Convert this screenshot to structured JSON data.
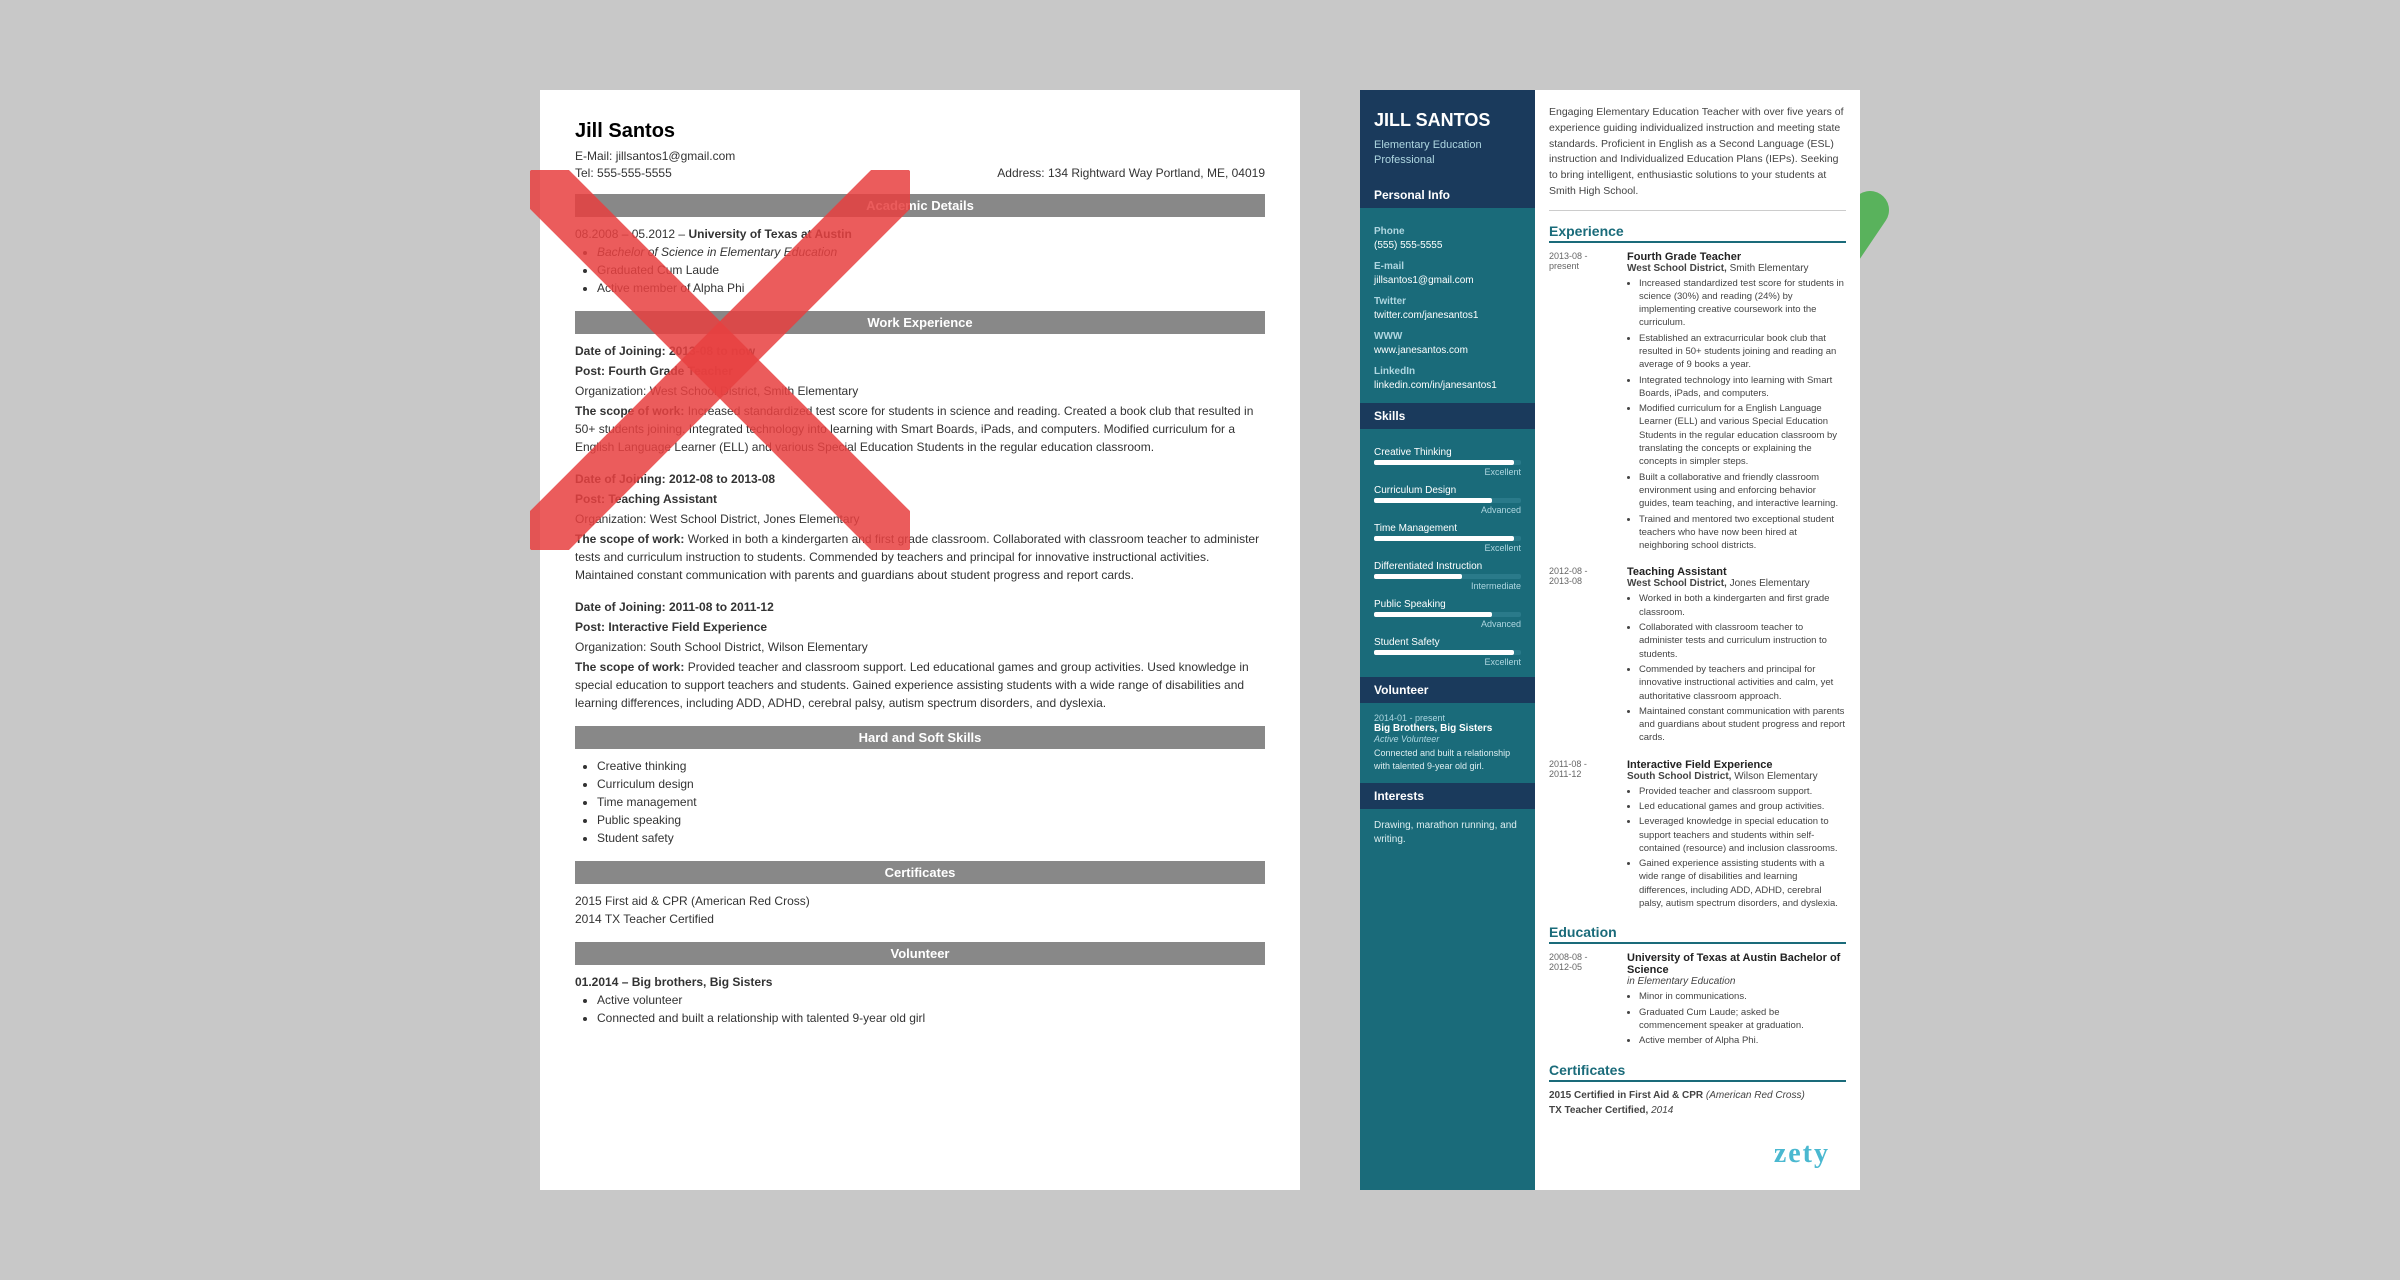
{
  "left": {
    "name": "Jill Santos",
    "email_label": "E-Mail:",
    "email": "jillsantos1@gmail.com",
    "address_label": "Address:",
    "address": "134 Rightward Way Portland, ME, 04019",
    "tel_label": "Tel:",
    "tel": "555-555-5555",
    "sections": {
      "academic": "Academic Details",
      "work": "Work Experience",
      "hard_soft": "Hard and Soft Skills",
      "certificates": "Certificates",
      "volunteer": "Volunteer"
    },
    "academic": {
      "dates": "08.2008 – 05.2012 –",
      "university": "University of Texas at Austin",
      "bullet1": "Bachelor of Science in Elementary Education",
      "bullet2": "Graduated Cum Laude",
      "bullet3": "Active member of Alpha Phi"
    },
    "work": [
      {
        "date": "Date of Joining: 2013-08 to now",
        "post": "Post: Fourth Grade Teacher",
        "org": "Organization: West School District, Smith Elementary",
        "scope_label": "The scope of work:",
        "scope": "Increased standardized test score for students in science and reading. Created a book club that resulted in 50+ students joining. Integrated technology into learning with Smart Boards, iPads, and computers. Modified curriculum for a English Language Learner (ELL) and various Special Education Students in the regular education classroom."
      },
      {
        "date": "Date of Joining: 2012-08 to 2013-08",
        "post": "Post: Teaching Assistant",
        "org": "Organization: West School District, Jones Elementary",
        "scope_label": "The scope of work:",
        "scope": "Worked in both a kindergarten and first grade classroom. Collaborated with classroom teacher to administer tests and curriculum instruction to students. Commended by teachers and principal for innovative instructional activities. Maintained constant communication with parents and guardians about student progress and report cards."
      },
      {
        "date": "Date of Joining: 2011-08 to 2011-12",
        "post": "Post: Interactive Field Experience",
        "org": "Organization: South School District, Wilson Elementary",
        "scope_label": "The scope of work:",
        "scope": "Provided teacher and classroom support. Led educational games and group activities. Used knowledge in special education to support teachers and students. Gained experience assisting students with a wide range of disabilities and learning differences, including ADD, ADHD, cerebral palsy, autism spectrum disorders, and dyslexia."
      }
    ],
    "skills": [
      "Creative thinking",
      "Curriculum design",
      "Time management",
      "Public speaking",
      "Student safety"
    ],
    "certs": [
      "2015 First aid & CPR (American Red Cross)",
      "2014 TX Teacher Certified"
    ],
    "volunteer": {
      "date": "01.2014 – Big brothers, Big Sisters",
      "bullet1": "Active volunteer",
      "bullet2": "Connected and built a relationship with talented 9-year old girl"
    }
  },
  "right": {
    "name": "JILL SANTOS",
    "title": "Elementary Education Professional",
    "summary": "Engaging Elementary Education Teacher with over five years of experience guiding individualized instruction and meeting state standards. Proficient in English as a Second Language (ESL) instruction and Individualized Education Plans (IEPs). Seeking to bring intelligent, enthusiastic solutions to your students at Smith High School.",
    "sidebar": {
      "personal_info": "Personal Info",
      "phone_label": "Phone",
      "phone": "(555) 555-5555",
      "email_label": "E-mail",
      "email": "jillsantos1@gmail.com",
      "twitter_label": "Twitter",
      "twitter": "twitter.com/janesantos1",
      "www_label": "WWW",
      "www": "www.janesantos.com",
      "linkedin_label": "LinkedIn",
      "linkedin": "linkedin.com/in/janesantos1",
      "skills_title": "Skills",
      "skills": [
        {
          "name": "Creative Thinking",
          "level": "Excellent",
          "pct": 95
        },
        {
          "name": "Curriculum Design",
          "level": "Advanced",
          "pct": 80
        },
        {
          "name": "Time Management",
          "level": "Excellent",
          "pct": 95
        },
        {
          "name": "Differentiated Instruction",
          "level": "Intermediate",
          "pct": 60
        },
        {
          "name": "Public Speaking",
          "level": "Advanced",
          "pct": 80
        },
        {
          "name": "Student Safety",
          "level": "Excellent",
          "pct": 95
        }
      ],
      "volunteer_title": "Volunteer",
      "volunteer": {
        "date": "2014-01 - present",
        "org": "Big Brothers, Big Sisters",
        "role": "Active Volunteer",
        "bullets": [
          "Connected and built a relationship with talented 9-year old girl."
        ]
      },
      "interests_title": "Interests",
      "interests": "Drawing, marathon running, and writing."
    },
    "experience_title": "Experience",
    "experience": [
      {
        "date_start": "2013-08 -",
        "date_end": "present",
        "title": "Fourth Grade Teacher",
        "org_bold": "West School District,",
        "org_rest": " Smith Elementary",
        "bullets": [
          "Increased standardized test score for students in science (30%) and reading (24%) by implementing creative coursework into the curriculum.",
          "Established an extracurricular book club that resulted in 50+ students joining and reading an average of 9 books a year.",
          "Integrated technology into learning with Smart Boards, iPads, and computers.",
          "Modified curriculum for a English Language Learner (ELL) and various Special Education Students in the regular education classroom by translating the concepts or explaining the concepts in simpler steps.",
          "Built a collaborative and friendly classroom environment using and enforcing behavior guides, team teaching, and interactive learning.",
          "Trained and mentored two exceptional student teachers who have now been hired at neighboring school districts."
        ]
      },
      {
        "date_start": "2012-08 -",
        "date_end": "2013-08",
        "title": "Teaching Assistant",
        "org_bold": "West School District,",
        "org_rest": " Jones Elementary",
        "bullets": [
          "Worked in both a kindergarten and first grade classroom.",
          "Collaborated with classroom teacher to administer tests and curriculum instruction to students.",
          "Commended by teachers and principal for innovative instructional activities and calm, yet authoritative classroom approach.",
          "Maintained constant communication with parents and guardians about student progress and report cards."
        ]
      },
      {
        "date_start": "2011-08 -",
        "date_end": "2011-12",
        "title": "Interactive Field Experience",
        "org_bold": "South School District,",
        "org_rest": " Wilson Elementary",
        "bullets": [
          "Provided teacher and classroom support.",
          "Led educational games and group activities.",
          "Leveraged knowledge in special education to support teachers and students within self-contained (resource) and inclusion classrooms.",
          "Gained experience assisting students with a wide range of disabilities and learning differences, including ADD, ADHD, cerebral palsy, autism spectrum disorders, and dyslexia."
        ]
      }
    ],
    "education_title": "Education",
    "education": [
      {
        "date_start": "2008-08 -",
        "date_end": "2012-05",
        "uni": "University of Texas at Austin",
        "degree": "Bachelor of Science",
        "field": "in Elementary Education",
        "bullets": [
          "Minor in communications.",
          "Graduated Cum Laude; asked be commencement speaker at graduation.",
          "Active member of Alpha Phi."
        ]
      }
    ],
    "certificates_title": "Certificates",
    "certificates": [
      {
        "year": "2015",
        "name": "Certified in First Aid & CPR",
        "org": "(American Red Cross)"
      },
      {
        "year": "",
        "name": "TX Teacher Certified,",
        "org": "2014"
      }
    ]
  },
  "watermark": "zety"
}
